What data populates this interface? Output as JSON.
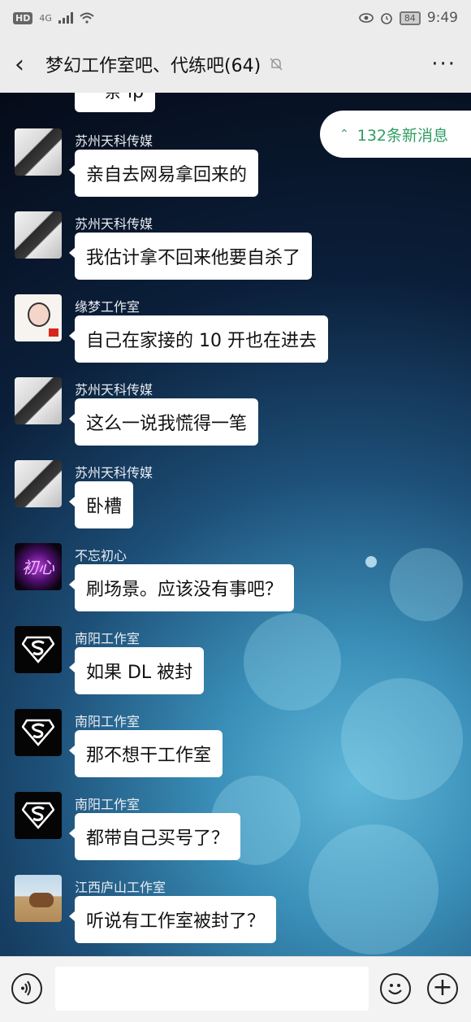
{
  "status_bar": {
    "hd": "HD",
    "network": "4G",
    "battery": "84",
    "time": "9:49"
  },
  "header": {
    "title": "梦幻工作室吧、代练吧(64)",
    "more": "···"
  },
  "new_messages": "132条新消息",
  "partial_message": "一条 ip",
  "messages": [
    {
      "sender": "苏州天科传媒",
      "text": "亲自去网易拿回来的",
      "avatar": "cat"
    },
    {
      "sender": "苏州天科传媒",
      "text": "我估计拿不回来他要自杀了",
      "avatar": "cat"
    },
    {
      "sender": "缘梦工作室",
      "text": "自己在家接的 10 开也在进去",
      "avatar": "girl"
    },
    {
      "sender": "苏州天科传媒",
      "text": "这么一说我慌得一笔",
      "avatar": "cat"
    },
    {
      "sender": "苏州天科传媒",
      "text": "卧槽",
      "avatar": "cat"
    },
    {
      "sender": "不忘初心",
      "text": "刷场景。应该没有事吧？",
      "avatar": "purple"
    },
    {
      "sender": "南阳工作室",
      "text": "如果 DL 被封",
      "avatar": "superman"
    },
    {
      "sender": "南阳工作室",
      "text": "那不想干工作室",
      "avatar": "superman"
    },
    {
      "sender": "南阳工作室",
      "text": "都带自己买号了？",
      "avatar": "superman"
    },
    {
      "sender": "江西庐山工作室",
      "text": "听说有工作室被封了？",
      "avatar": "horse"
    }
  ],
  "icons": {
    "back": "chevron-left-icon",
    "mute": "bell-off-icon",
    "more": "more-dots-icon",
    "voice": "voice-icon",
    "emoji": "emoji-icon",
    "add": "plus-icon"
  }
}
